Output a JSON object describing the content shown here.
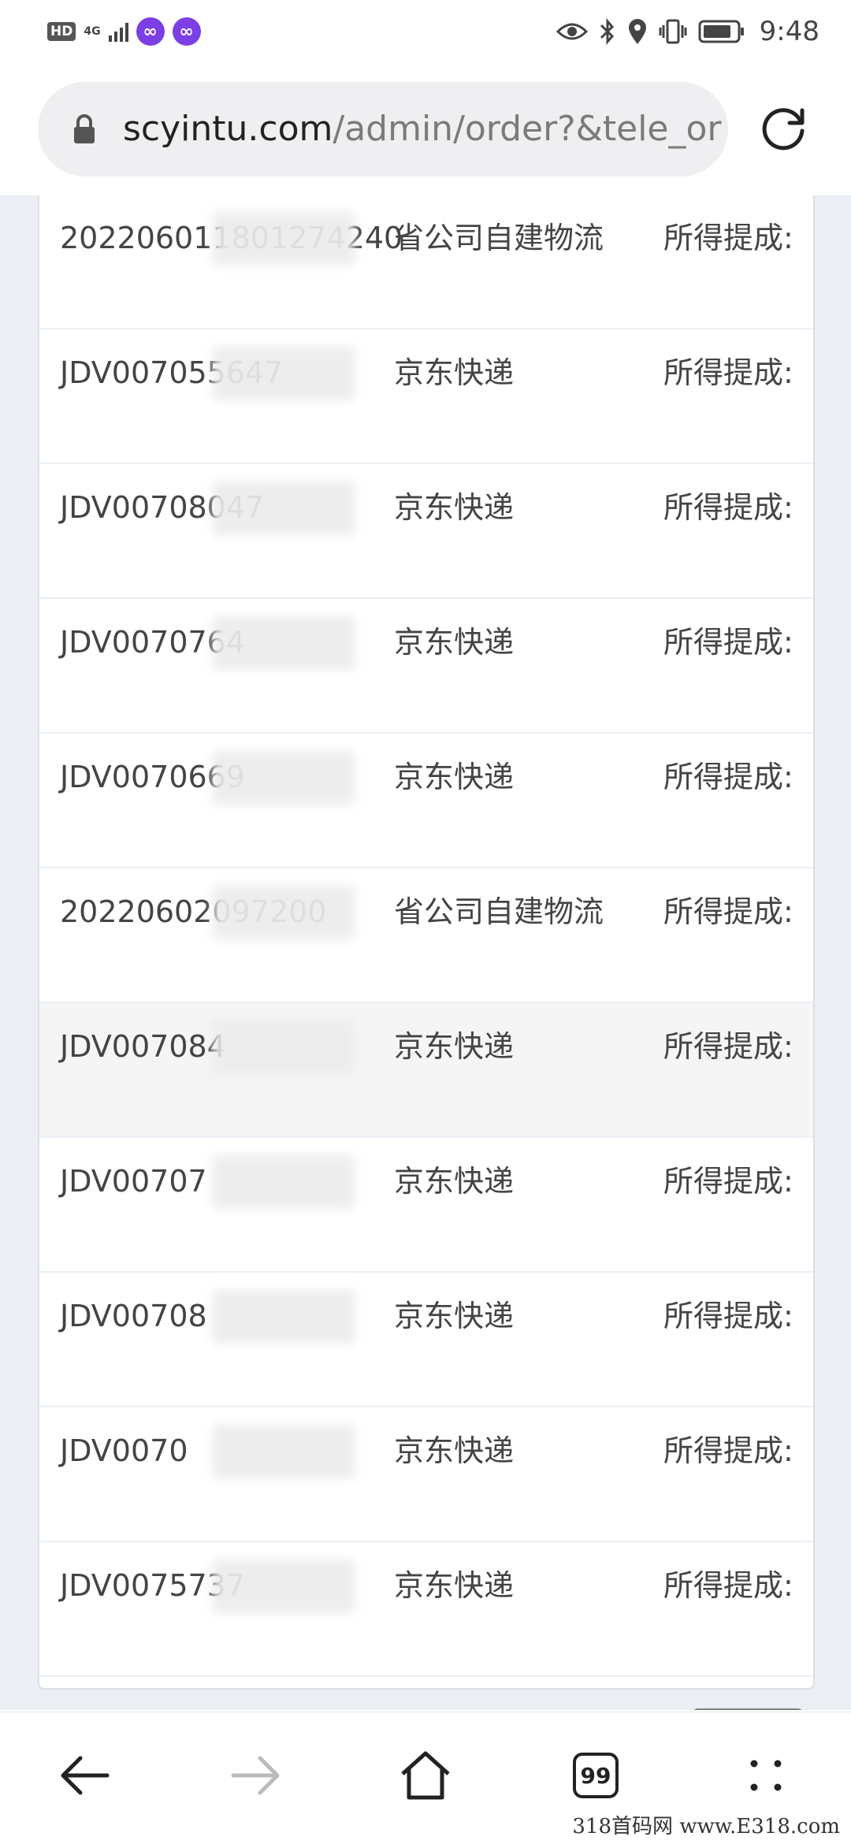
{
  "status_bar": {
    "hd": "HD",
    "network": "4G",
    "time": "9:48"
  },
  "browser": {
    "url_domain": "scyintu.com",
    "url_path": "/admin/order?&tele_or",
    "tabs_count": "99"
  },
  "orders": [
    {
      "order_no": "202206011801274240",
      "shipping": "省公司自建物流",
      "commission": "所得提成:",
      "highlighted": false
    },
    {
      "order_no": "JDV007055647",
      "shipping": "京东快递",
      "commission": "所得提成:",
      "highlighted": false
    },
    {
      "order_no": "JDV00708047",
      "shipping": "京东快递",
      "commission": "所得提成:",
      "highlighted": false
    },
    {
      "order_no": "JDV0070764",
      "shipping": "京东快递",
      "commission": "所得提成:",
      "highlighted": false
    },
    {
      "order_no": "JDV0070669",
      "shipping": "京东快递",
      "commission": "所得提成:",
      "highlighted": false
    },
    {
      "order_no": "20220602097200",
      "shipping": "省公司自建物流",
      "commission": "所得提成:",
      "highlighted": false
    },
    {
      "order_no": "JDV007084",
      "shipping": "京东快递",
      "commission": "所得提成:",
      "highlighted": true
    },
    {
      "order_no": "JDV00707",
      "shipping": "京东快递",
      "commission": "所得提成:",
      "highlighted": false
    },
    {
      "order_no": "JDV00708",
      "shipping": "京东快递",
      "commission": "所得提成:",
      "highlighted": false
    },
    {
      "order_no": "JDV0070",
      "shipping": "京东快递",
      "commission": "所得提成:",
      "highlighted": false
    },
    {
      "order_no": "JDV0075737",
      "shipping": "京东快递",
      "commission": "所得提成:",
      "highlighted": false
    }
  ],
  "watermark": "318首码网 www.E318.com",
  "icons": [
    "eye-icon",
    "bluetooth-icon",
    "location-icon",
    "vibrate-icon",
    "battery-icon",
    "lock-icon",
    "reload-icon",
    "back-arrow-icon",
    "forward-arrow-icon",
    "home-icon",
    "tabs-icon",
    "more-icon",
    "chevron-up-icon"
  ],
  "colors": {
    "infinity_badge": "#7b3fe4",
    "scroll_top_button": "#8c9192"
  }
}
